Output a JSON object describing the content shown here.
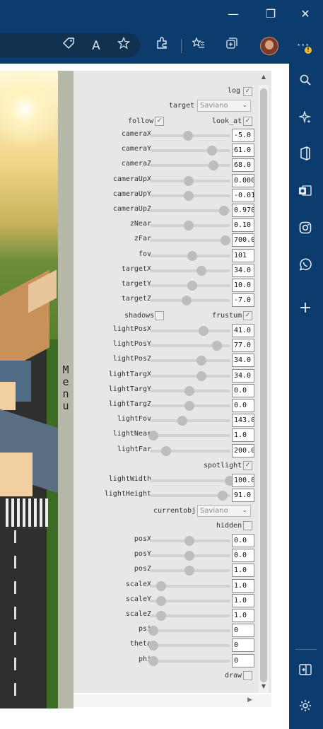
{
  "browser": {
    "window_controls": {
      "minimize": "—",
      "restore": "❐",
      "close": "✕"
    },
    "toolbar_icons": [
      "tag-icon",
      "read-aloud-icon",
      "favorite-add-icon",
      "extensions-icon",
      "favorites-icon",
      "collections-icon",
      "profile-avatar",
      "more-icon"
    ],
    "read_aloud_glyph": "A",
    "more_glyph": "···",
    "more_badge": "!",
    "sidebar_icons": [
      "search-icon",
      "copilot-icon",
      "office-icon",
      "outlook-icon",
      "instagram-icon",
      "whatsapp-icon",
      "add-icon",
      "split-screen-icon",
      "settings-icon"
    ],
    "add_glyph": "+"
  },
  "menu": {
    "label": "Menu"
  },
  "controls": {
    "log": {
      "label": "log",
      "checked": true
    },
    "target": {
      "label": "target",
      "value": "Saviano"
    },
    "follow": {
      "label": "follow",
      "checked": true
    },
    "look_at": {
      "label": "look_at",
      "checked": true
    },
    "sliders1": [
      {
        "label": "cameraX",
        "value": "-5.0",
        "level": 0.47
      },
      {
        "label": "cameraY",
        "value": "61.0",
        "level": 0.77
      },
      {
        "label": "cameraZ",
        "value": "68.0",
        "level": 0.79
      },
      {
        "label": "cameraUpX",
        "value": "0.000",
        "level": 0.48
      },
      {
        "label": "cameraUpY",
        "value": "-0.01",
        "level": 0.48
      },
      {
        "label": "cameraUpZ",
        "value": "0.970",
        "level": 0.92
      },
      {
        "label": "zNear",
        "value": "0.10",
        "level": 0.48
      },
      {
        "label": "zFar",
        "value": "700.0",
        "level": 0.94
      },
      {
        "label": "fov",
        "value": "101",
        "level": 0.53
      },
      {
        "label": "targetX",
        "value": "34.0",
        "level": 0.64
      },
      {
        "label": "targetY",
        "value": "10.0",
        "level": 0.53
      },
      {
        "label": "targetZ",
        "value": "-7.0",
        "level": 0.46
      }
    ],
    "shadows": {
      "label": "shadows",
      "checked": false
    },
    "frustum": {
      "label": "frustum",
      "checked": true
    },
    "sliders2": [
      {
        "label": "lightPosX",
        "value": "41.0",
        "level": 0.67
      },
      {
        "label": "lightPosY",
        "value": "77.0",
        "level": 0.83
      },
      {
        "label": "lightPosZ",
        "value": "34.0",
        "level": 0.64
      },
      {
        "label": "lightTargX",
        "value": "34.0",
        "level": 0.64
      },
      {
        "label": "lightTargY",
        "value": "0.0",
        "level": 0.49
      },
      {
        "label": "lightTargZ",
        "value": "0.0",
        "level": 0.49
      },
      {
        "label": "lightFov",
        "value": "143.0",
        "level": 0.4
      },
      {
        "label": "lightNear",
        "value": "1.0",
        "level": 0.04
      },
      {
        "label": "lightFar",
        "value": "200.0",
        "level": 0.2
      }
    ],
    "spotlight": {
      "label": "spotlight",
      "checked": true
    },
    "sliders3": [
      {
        "label": "lightWidth",
        "value": "100.0",
        "level": 0.99
      },
      {
        "label": "lightHeight",
        "value": "91.0",
        "level": 0.9
      }
    ],
    "currentobj": {
      "label": "currentobj",
      "value": "Saviano"
    },
    "hidden": {
      "label": "hidden",
      "checked": false
    },
    "sliders4": [
      {
        "label": "posX",
        "value": "0.0",
        "level": 0.49
      },
      {
        "label": "posY",
        "value": "0.0",
        "level": 0.49
      },
      {
        "label": "posZ",
        "value": "1.0",
        "level": 0.49
      },
      {
        "label": "scaleX",
        "value": "1.0",
        "level": 0.14
      },
      {
        "label": "scaleY",
        "value": "1.0",
        "level": 0.14
      },
      {
        "label": "scaleZ",
        "value": "1.0",
        "level": 0.14
      },
      {
        "label": "psi",
        "value": "0",
        "level": 0.04
      },
      {
        "label": "theta",
        "value": "0",
        "level": 0.04
      },
      {
        "label": "phi",
        "value": "0",
        "level": 0.04
      }
    ],
    "draw": {
      "label": "draw",
      "checked": false
    }
  }
}
